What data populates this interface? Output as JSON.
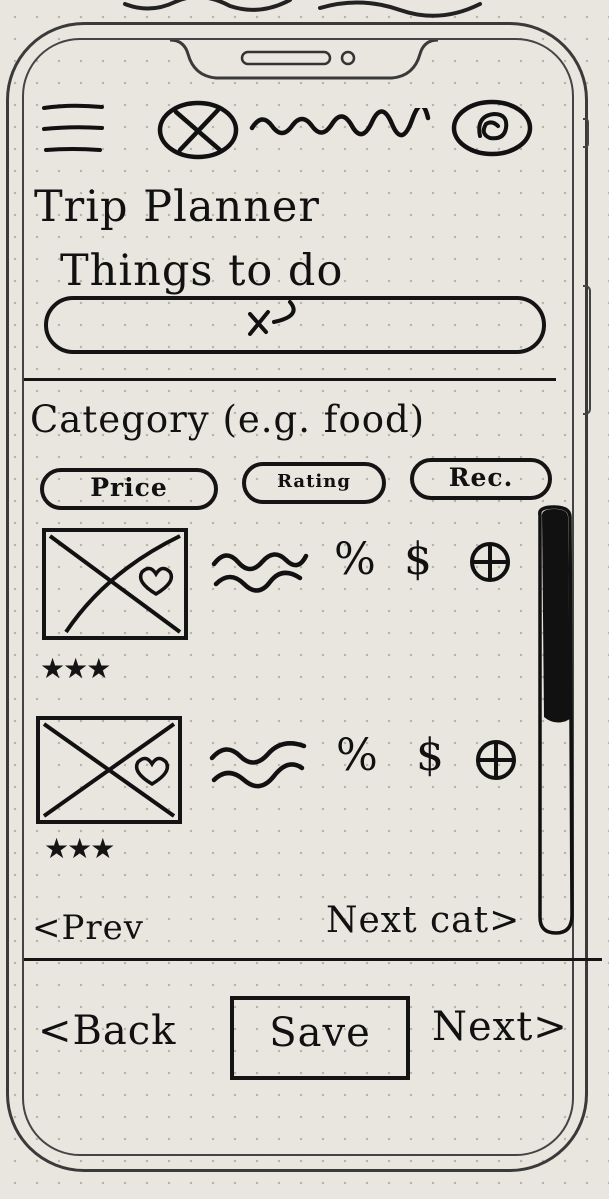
{
  "app": {
    "title": "Trip Planner",
    "subtitle": "Things to do"
  },
  "header": {
    "menu_icon": "hamburger-menu-icon",
    "logo_icon": "x-circle-logo-icon",
    "profile_icon": "profile-swirl-icon"
  },
  "search": {
    "icon": "search-icon"
  },
  "filters": {
    "category_label": "Category (e.g. food)",
    "chips": [
      {
        "label": "Price"
      },
      {
        "label": "Rating"
      },
      {
        "label": "Rec."
      }
    ]
  },
  "results": {
    "items": [
      {
        "rating": "★★★",
        "price_percent": "%",
        "price_symbol": "$"
      },
      {
        "rating": "★★★",
        "price_percent": "%",
        "price_symbol": "$"
      }
    ]
  },
  "pagination": {
    "prev_label": "<Prev",
    "next_label": "Next cat>"
  },
  "footer": {
    "back_label": "<Back",
    "save_label": "Save",
    "next_label": "Next>"
  }
}
